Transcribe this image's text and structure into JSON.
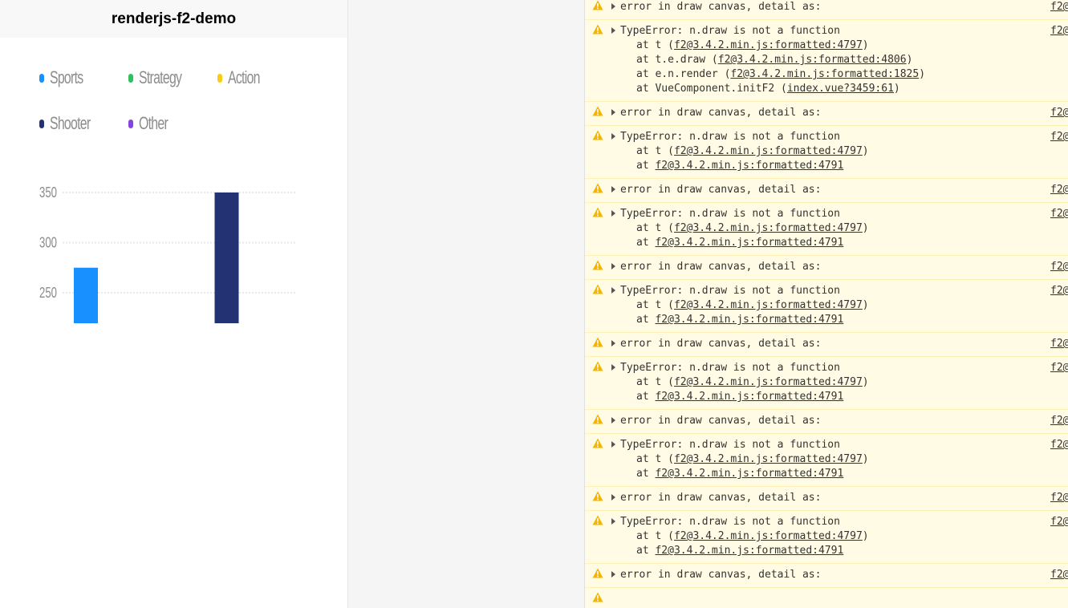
{
  "app": {
    "title": "renderjs-f2-demo"
  },
  "legend": [
    {
      "label": "Sports",
      "color": "#1890FF"
    },
    {
      "label": "Strategy",
      "color": "#2FC25B"
    },
    {
      "label": "Action",
      "color": "#FACC14"
    },
    {
      "label": "Shooter",
      "color": "#223273"
    },
    {
      "label": "Other",
      "color": "#8543E0"
    }
  ],
  "chart_data": {
    "type": "bar",
    "categories": [
      "Sports",
      "Strategy",
      "Action",
      "Shooter",
      "Other"
    ],
    "values": [
      275,
      null,
      null,
      350,
      null
    ],
    "colors": [
      "#1890FF",
      "#2FC25B",
      "#FACC14",
      "#223273",
      "#8543E0"
    ],
    "yticks": [
      "350",
      "300",
      "250"
    ],
    "ytick_values": [
      350,
      300,
      250
    ],
    "ylim": [
      220,
      350
    ],
    "grid": true,
    "legend_position": "top"
  },
  "console": {
    "source_short": "f2@",
    "entries": [
      {
        "message": "error in draw canvas, detail as:",
        "frames": []
      },
      {
        "message": "TypeError: n.draw is not a function",
        "frames": [
          {
            "prefix": "at t (",
            "link": "f2@3.4.2.min.js:formatted:4797",
            "suffix": ")"
          },
          {
            "prefix": "at t.e.draw (",
            "link": "f2@3.4.2.min.js:formatted:4806",
            "suffix": ")"
          },
          {
            "prefix": "at e.n.render (",
            "link": "f2@3.4.2.min.js:formatted:1825",
            "suffix": ")"
          },
          {
            "prefix": "at VueComponent.initF2 (",
            "link": "index.vue?3459:61",
            "suffix": ")"
          }
        ]
      },
      {
        "message": "error in draw canvas, detail as:",
        "frames": []
      },
      {
        "message": "TypeError: n.draw is not a function",
        "frames": [
          {
            "prefix": "at t (",
            "link": "f2@3.4.2.min.js:formatted:4797",
            "suffix": ")"
          },
          {
            "prefix": "at ",
            "link": "f2@3.4.2.min.js:formatted:4791",
            "suffix": ""
          }
        ]
      },
      {
        "message": "error in draw canvas, detail as:",
        "frames": []
      },
      {
        "message": "TypeError: n.draw is not a function",
        "frames": [
          {
            "prefix": "at t (",
            "link": "f2@3.4.2.min.js:formatted:4797",
            "suffix": ")"
          },
          {
            "prefix": "at ",
            "link": "f2@3.4.2.min.js:formatted:4791",
            "suffix": ""
          }
        ]
      },
      {
        "message": "error in draw canvas, detail as:",
        "frames": []
      },
      {
        "message": "TypeError: n.draw is not a function",
        "frames": [
          {
            "prefix": "at t (",
            "link": "f2@3.4.2.min.js:formatted:4797",
            "suffix": ")"
          },
          {
            "prefix": "at ",
            "link": "f2@3.4.2.min.js:formatted:4791",
            "suffix": ""
          }
        ]
      },
      {
        "message": "error in draw canvas, detail as:",
        "frames": []
      },
      {
        "message": "TypeError: n.draw is not a function",
        "frames": [
          {
            "prefix": "at t (",
            "link": "f2@3.4.2.min.js:formatted:4797",
            "suffix": ")"
          },
          {
            "prefix": "at ",
            "link": "f2@3.4.2.min.js:formatted:4791",
            "suffix": ""
          }
        ]
      },
      {
        "message": "error in draw canvas, detail as:",
        "frames": []
      },
      {
        "message": "TypeError: n.draw is not a function",
        "frames": [
          {
            "prefix": "at t (",
            "link": "f2@3.4.2.min.js:formatted:4797",
            "suffix": ")"
          },
          {
            "prefix": "at ",
            "link": "f2@3.4.2.min.js:formatted:4791",
            "suffix": ""
          }
        ]
      },
      {
        "message": "error in draw canvas, detail as:",
        "frames": []
      },
      {
        "message": "TypeError: n.draw is not a function",
        "frames": [
          {
            "prefix": "at t (",
            "link": "f2@3.4.2.min.js:formatted:4797",
            "suffix": ")"
          },
          {
            "prefix": "at ",
            "link": "f2@3.4.2.min.js:formatted:4791",
            "suffix": ""
          }
        ]
      },
      {
        "message": "error in draw canvas, detail as:",
        "frames": []
      },
      {
        "message": "",
        "frames": []
      }
    ]
  }
}
